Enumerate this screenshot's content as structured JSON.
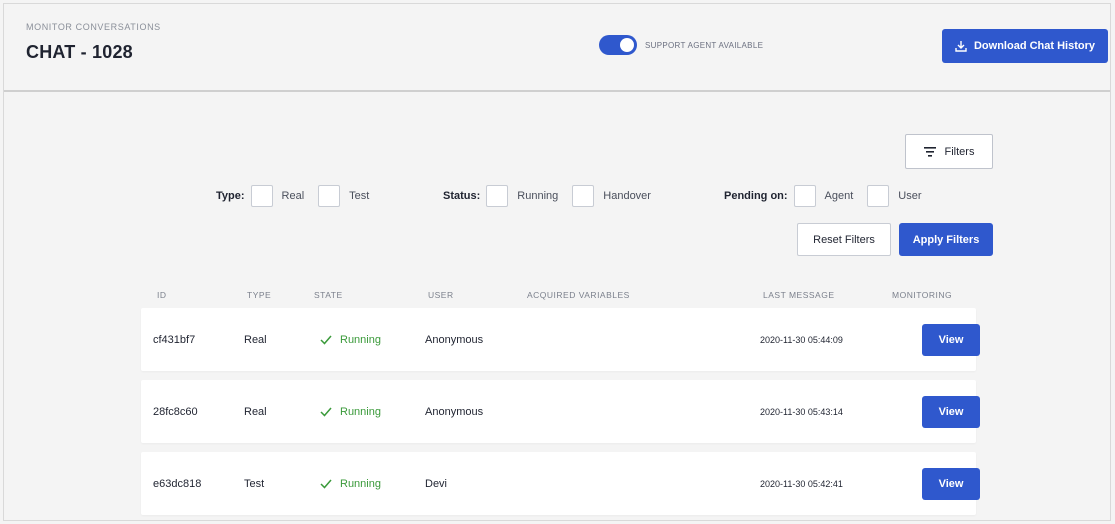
{
  "header": {
    "eyebrow": "MONITOR CONVERSATIONS",
    "title": "CHAT - 1028",
    "toggle_label": "SUPPORT AGENT AVAILABLE",
    "toggle_on": true,
    "download_label": "Download Chat History"
  },
  "filters": {
    "button_label": "Filters",
    "groups": [
      {
        "label": "Type:",
        "options": [
          "Real",
          "Test"
        ]
      },
      {
        "label": "Status:",
        "options": [
          "Running",
          "Handover"
        ]
      },
      {
        "label": "Pending on:",
        "options": [
          "Agent",
          "User"
        ]
      }
    ],
    "reset_label": "Reset Filters",
    "apply_label": "Apply Filters"
  },
  "table": {
    "columns": [
      "ID",
      "TYPE",
      "STATE",
      "USER",
      "ACQUIRED VARIABLES",
      "LAST MESSAGE",
      "MONITORING"
    ],
    "rows": [
      {
        "id": "cf431bf7",
        "type": "Real",
        "state": "Running",
        "user": "Anonymous",
        "variables": "",
        "last_message": "2020-11-30 05:44:09",
        "action": "View"
      },
      {
        "id": "28fc8c60",
        "type": "Real",
        "state": "Running",
        "user": "Anonymous",
        "variables": "",
        "last_message": "2020-11-30 05:43:14",
        "action": "View"
      },
      {
        "id": "e63dc818",
        "type": "Test",
        "state": "Running",
        "user": "Devi",
        "variables": "",
        "last_message": "2020-11-30 05:42:41",
        "action": "View"
      }
    ]
  },
  "icons": {
    "download": "download-icon",
    "filter": "filter-lines-icon",
    "state": "check-icon"
  },
  "colors": {
    "primary": "#2f58cd",
    "success": "#3a9a3a",
    "background": "#f4f4f4"
  }
}
